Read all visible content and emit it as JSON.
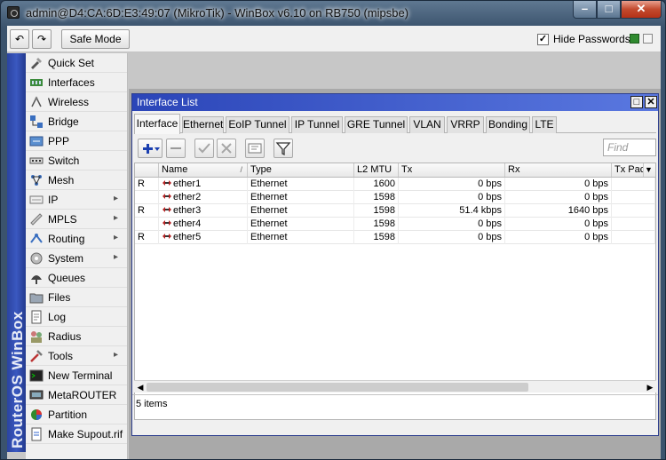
{
  "window": {
    "title": "admin@D4:CA:6D:E3:49:07 (MikroTik) - WinBox v6.10 on RB750 (mipsbe)",
    "min_glyph": "–",
    "max_glyph": "□",
    "close_glyph": "✕"
  },
  "toolbar": {
    "undo_glyph": "↶",
    "redo_glyph": "↷",
    "safe_mode_label": "Safe Mode",
    "hide_passwords_label": "Hide Passwords",
    "hide_passwords_checked": "✓"
  },
  "brand": "RouterOS WinBox",
  "menu": [
    {
      "label": "Quick Set",
      "icon": "quick-set-icon",
      "submenu": false
    },
    {
      "label": "Interfaces",
      "icon": "interfaces-icon",
      "submenu": false
    },
    {
      "label": "Wireless",
      "icon": "wireless-icon",
      "submenu": false
    },
    {
      "label": "Bridge",
      "icon": "bridge-icon",
      "submenu": false
    },
    {
      "label": "PPP",
      "icon": "ppp-icon",
      "submenu": false
    },
    {
      "label": "Switch",
      "icon": "switch-icon",
      "submenu": false
    },
    {
      "label": "Mesh",
      "icon": "mesh-icon",
      "submenu": false
    },
    {
      "label": "IP",
      "icon": "ip-icon",
      "submenu": true
    },
    {
      "label": "MPLS",
      "icon": "mpls-icon",
      "submenu": true
    },
    {
      "label": "Routing",
      "icon": "routing-icon",
      "submenu": true
    },
    {
      "label": "System",
      "icon": "system-icon",
      "submenu": true
    },
    {
      "label": "Queues",
      "icon": "queues-icon",
      "submenu": false
    },
    {
      "label": "Files",
      "icon": "files-icon",
      "submenu": false
    },
    {
      "label": "Log",
      "icon": "log-icon",
      "submenu": false
    },
    {
      "label": "Radius",
      "icon": "radius-icon",
      "submenu": false
    },
    {
      "label": "Tools",
      "icon": "tools-icon",
      "submenu": true
    },
    {
      "label": "New Terminal",
      "icon": "terminal-icon",
      "submenu": false
    },
    {
      "label": "MetaROUTER",
      "icon": "metarouter-icon",
      "submenu": false
    },
    {
      "label": "Partition",
      "icon": "partition-icon",
      "submenu": false
    },
    {
      "label": "Make Supout.rif",
      "icon": "supout-icon",
      "submenu": false
    }
  ],
  "submenu_glyph": "▸",
  "interface_list": {
    "title": "Interface List",
    "max_glyph": "□",
    "close_glyph": "✕",
    "tabs": [
      "Interface",
      "Ethernet",
      "EoIP Tunnel",
      "IP Tunnel",
      "GRE Tunnel",
      "VLAN",
      "VRRP",
      "Bonding",
      "LTE"
    ],
    "active_tab": "Interface",
    "find_placeholder": "Find",
    "columns": [
      "",
      "Name",
      "Type",
      "L2 MTU",
      "Tx",
      "Rx",
      "Tx Pac"
    ],
    "rows": [
      {
        "flag": "R",
        "name": "ether1",
        "type": "Ethernet",
        "l2mtu": "1600",
        "tx": "0 bps",
        "rx": "0 bps"
      },
      {
        "flag": "",
        "name": "ether2",
        "type": "Ethernet",
        "l2mtu": "1598",
        "tx": "0 bps",
        "rx": "0 bps"
      },
      {
        "flag": "R",
        "name": "ether3",
        "type": "Ethernet",
        "l2mtu": "1598",
        "tx": "51.4 kbps",
        "rx": "1640 bps"
      },
      {
        "flag": "",
        "name": "ether4",
        "type": "Ethernet",
        "l2mtu": "1598",
        "tx": "0 bps",
        "rx": "0 bps"
      },
      {
        "flag": "R",
        "name": "ether5",
        "type": "Ethernet",
        "l2mtu": "1598",
        "tx": "0 bps",
        "rx": "0 bps"
      }
    ],
    "status": "5 items",
    "sort_glyph": "/",
    "column_menu_glyph": "▼",
    "scroll_left_glyph": "◀",
    "scroll_right_glyph": "▶"
  },
  "colors": {
    "accent_blue": "#2b45b8",
    "add_plus": "#1a3fb0",
    "ok_green": "#2f8a2f"
  }
}
